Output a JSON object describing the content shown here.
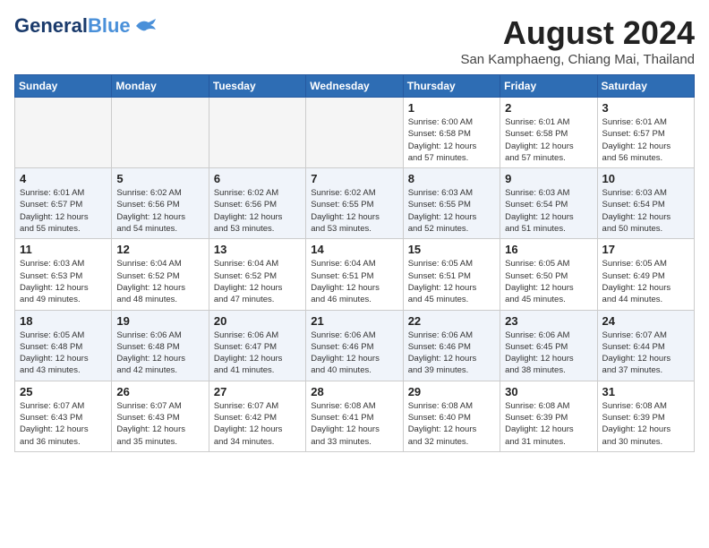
{
  "header": {
    "logo_general": "General",
    "logo_blue": "Blue",
    "month_title": "August 2024",
    "location": "San Kamphaeng, Chiang Mai, Thailand"
  },
  "weekdays": [
    "Sunday",
    "Monday",
    "Tuesday",
    "Wednesday",
    "Thursday",
    "Friday",
    "Saturday"
  ],
  "weeks": [
    [
      {
        "num": "",
        "info": ""
      },
      {
        "num": "",
        "info": ""
      },
      {
        "num": "",
        "info": ""
      },
      {
        "num": "",
        "info": ""
      },
      {
        "num": "1",
        "info": "Sunrise: 6:00 AM\nSunset: 6:58 PM\nDaylight: 12 hours\nand 57 minutes."
      },
      {
        "num": "2",
        "info": "Sunrise: 6:01 AM\nSunset: 6:58 PM\nDaylight: 12 hours\nand 57 minutes."
      },
      {
        "num": "3",
        "info": "Sunrise: 6:01 AM\nSunset: 6:57 PM\nDaylight: 12 hours\nand 56 minutes."
      }
    ],
    [
      {
        "num": "4",
        "info": "Sunrise: 6:01 AM\nSunset: 6:57 PM\nDaylight: 12 hours\nand 55 minutes."
      },
      {
        "num": "5",
        "info": "Sunrise: 6:02 AM\nSunset: 6:56 PM\nDaylight: 12 hours\nand 54 minutes."
      },
      {
        "num": "6",
        "info": "Sunrise: 6:02 AM\nSunset: 6:56 PM\nDaylight: 12 hours\nand 53 minutes."
      },
      {
        "num": "7",
        "info": "Sunrise: 6:02 AM\nSunset: 6:55 PM\nDaylight: 12 hours\nand 53 minutes."
      },
      {
        "num": "8",
        "info": "Sunrise: 6:03 AM\nSunset: 6:55 PM\nDaylight: 12 hours\nand 52 minutes."
      },
      {
        "num": "9",
        "info": "Sunrise: 6:03 AM\nSunset: 6:54 PM\nDaylight: 12 hours\nand 51 minutes."
      },
      {
        "num": "10",
        "info": "Sunrise: 6:03 AM\nSunset: 6:54 PM\nDaylight: 12 hours\nand 50 minutes."
      }
    ],
    [
      {
        "num": "11",
        "info": "Sunrise: 6:03 AM\nSunset: 6:53 PM\nDaylight: 12 hours\nand 49 minutes."
      },
      {
        "num": "12",
        "info": "Sunrise: 6:04 AM\nSunset: 6:52 PM\nDaylight: 12 hours\nand 48 minutes."
      },
      {
        "num": "13",
        "info": "Sunrise: 6:04 AM\nSunset: 6:52 PM\nDaylight: 12 hours\nand 47 minutes."
      },
      {
        "num": "14",
        "info": "Sunrise: 6:04 AM\nSunset: 6:51 PM\nDaylight: 12 hours\nand 46 minutes."
      },
      {
        "num": "15",
        "info": "Sunrise: 6:05 AM\nSunset: 6:51 PM\nDaylight: 12 hours\nand 45 minutes."
      },
      {
        "num": "16",
        "info": "Sunrise: 6:05 AM\nSunset: 6:50 PM\nDaylight: 12 hours\nand 45 minutes."
      },
      {
        "num": "17",
        "info": "Sunrise: 6:05 AM\nSunset: 6:49 PM\nDaylight: 12 hours\nand 44 minutes."
      }
    ],
    [
      {
        "num": "18",
        "info": "Sunrise: 6:05 AM\nSunset: 6:48 PM\nDaylight: 12 hours\nand 43 minutes."
      },
      {
        "num": "19",
        "info": "Sunrise: 6:06 AM\nSunset: 6:48 PM\nDaylight: 12 hours\nand 42 minutes."
      },
      {
        "num": "20",
        "info": "Sunrise: 6:06 AM\nSunset: 6:47 PM\nDaylight: 12 hours\nand 41 minutes."
      },
      {
        "num": "21",
        "info": "Sunrise: 6:06 AM\nSunset: 6:46 PM\nDaylight: 12 hours\nand 40 minutes."
      },
      {
        "num": "22",
        "info": "Sunrise: 6:06 AM\nSunset: 6:46 PM\nDaylight: 12 hours\nand 39 minutes."
      },
      {
        "num": "23",
        "info": "Sunrise: 6:06 AM\nSunset: 6:45 PM\nDaylight: 12 hours\nand 38 minutes."
      },
      {
        "num": "24",
        "info": "Sunrise: 6:07 AM\nSunset: 6:44 PM\nDaylight: 12 hours\nand 37 minutes."
      }
    ],
    [
      {
        "num": "25",
        "info": "Sunrise: 6:07 AM\nSunset: 6:43 PM\nDaylight: 12 hours\nand 36 minutes."
      },
      {
        "num": "26",
        "info": "Sunrise: 6:07 AM\nSunset: 6:43 PM\nDaylight: 12 hours\nand 35 minutes."
      },
      {
        "num": "27",
        "info": "Sunrise: 6:07 AM\nSunset: 6:42 PM\nDaylight: 12 hours\nand 34 minutes."
      },
      {
        "num": "28",
        "info": "Sunrise: 6:08 AM\nSunset: 6:41 PM\nDaylight: 12 hours\nand 33 minutes."
      },
      {
        "num": "29",
        "info": "Sunrise: 6:08 AM\nSunset: 6:40 PM\nDaylight: 12 hours\nand 32 minutes."
      },
      {
        "num": "30",
        "info": "Sunrise: 6:08 AM\nSunset: 6:39 PM\nDaylight: 12 hours\nand 31 minutes."
      },
      {
        "num": "31",
        "info": "Sunrise: 6:08 AM\nSunset: 6:39 PM\nDaylight: 12 hours\nand 30 minutes."
      }
    ]
  ]
}
